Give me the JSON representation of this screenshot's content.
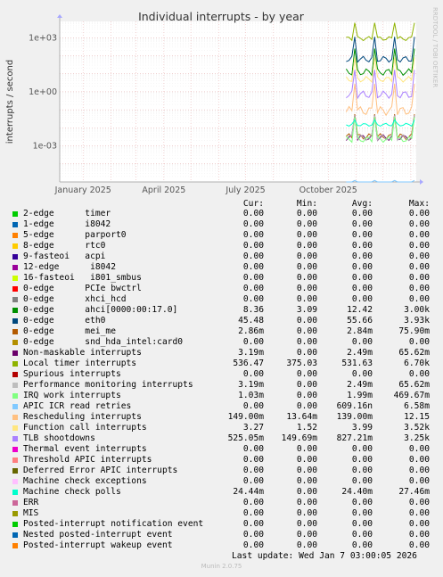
{
  "side_label": "RRDTOOL / TOBI OETIKER",
  "headers": {
    "cur": "Cur:",
    "min": "Min:",
    "avg": "Avg:",
    "max": "Max:"
  },
  "chart_data": {
    "type": "line",
    "title": "Individual interrupts - by year",
    "ylabel": "interrupts / second",
    "y_scale": "log",
    "ylim": [
      1e-05,
      8000
    ],
    "yticks": [
      {
        "v": 0.001,
        "label": "1e-03"
      },
      {
        "v": 1,
        "label": "1e+00"
      },
      {
        "v": 1000,
        "label": "1e+03"
      }
    ],
    "x_domain": [
      "2024-12-06",
      "2026-01-07"
    ],
    "xticks": [
      {
        "d": "2025-01-01",
        "label": "January 2025"
      },
      {
        "d": "2025-04-01",
        "label": "April 2025"
      },
      {
        "d": "2025-07-01",
        "label": "July 2025"
      },
      {
        "d": "2025-10-01",
        "label": "October 2025"
      }
    ],
    "data_start": "2025-10-21",
    "grid": true,
    "series": [
      {
        "name": "2-edge      timer",
        "color": "#00cc00",
        "cur": "0.00",
        "min": "0.00",
        "avg": "0.00",
        "max": "0.00"
      },
      {
        "name": "1-edge      i8042",
        "color": "#0066b3",
        "cur": "0.00",
        "min": "0.00",
        "avg": "0.00",
        "max": "0.00"
      },
      {
        "name": "5-edge      parport0",
        "color": "#ff8000",
        "cur": "0.00",
        "min": "0.00",
        "avg": "0.00",
        "max": "0.00"
      },
      {
        "name": "8-edge      rtc0",
        "color": "#ffcc00",
        "cur": "0.00",
        "min": "0.00",
        "avg": "0.00",
        "max": "0.00"
      },
      {
        "name": "9-fasteoi   acpi",
        "color": "#330099",
        "cur": "0.00",
        "min": "0.00",
        "avg": "0.00",
        "max": "0.00"
      },
      {
        "name": "12-edge      i8042",
        "color": "#990099",
        "cur": "0.00",
        "min": "0.00",
        "avg": "0.00",
        "max": "0.00"
      },
      {
        "name": "16-fasteoi   i801_smbus",
        "color": "#ccff00",
        "cur": "0.00",
        "min": "0.00",
        "avg": "0.00",
        "max": "0.00"
      },
      {
        "name": "0-edge      PCIe bwctrl",
        "color": "#ff0000",
        "cur": "0.00",
        "min": "0.00",
        "avg": "0.00",
        "max": "0.00"
      },
      {
        "name": "0-edge      xhci_hcd",
        "color": "#808080",
        "cur": "0.00",
        "min": "0.00",
        "avg": "0.00",
        "max": "0.00"
      },
      {
        "name": "0-edge      ahci[0000:00:17.0]",
        "color": "#008f00",
        "cur": "8.36",
        "min": "3.09",
        "avg": "12.42",
        "max": "3.00k"
      },
      {
        "name": "0-edge      eth0",
        "color": "#00487d",
        "cur": "45.48",
        "min": "0.00",
        "avg": "55.66",
        "max": "3.93k"
      },
      {
        "name": "0-edge      mei_me",
        "color": "#b35a00",
        "cur": "2.86m",
        "min": "0.00",
        "avg": "2.84m",
        "max": "75.90m"
      },
      {
        "name": "0-edge      snd_hda_intel:card0",
        "color": "#b38f00",
        "cur": "0.00",
        "min": "0.00",
        "avg": "0.00",
        "max": "0.00"
      },
      {
        "name": "Non-maskable interrupts",
        "color": "#6b006b",
        "cur": "3.19m",
        "min": "0.00",
        "avg": "2.49m",
        "max": "65.62m"
      },
      {
        "name": "Local timer interrupts",
        "color": "#8fb300",
        "cur": "536.47",
        "min": "375.03",
        "avg": "531.63",
        "max": "6.70k"
      },
      {
        "name": "Spurious interrupts",
        "color": "#b30000",
        "cur": "0.00",
        "min": "0.00",
        "avg": "0.00",
        "max": "0.00"
      },
      {
        "name": "Performance monitoring interrupts",
        "color": "#bebebe",
        "cur": "3.19m",
        "min": "0.00",
        "avg": "2.49m",
        "max": "65.62m"
      },
      {
        "name": "IRQ work interrupts",
        "color": "#80ff80",
        "cur": "1.03m",
        "min": "0.00",
        "avg": "1.99m",
        "max": "469.67m"
      },
      {
        "name": "APIC ICR read retries",
        "color": "#80c9ff",
        "cur": "0.00",
        "min": "0.00",
        "avg": "609.16n",
        "max": "6.58m"
      },
      {
        "name": "Rescheduling interrupts",
        "color": "#ffc080",
        "cur": "149.00m",
        "min": "13.64m",
        "avg": "139.00m",
        "max": "12.15"
      },
      {
        "name": "Function call interrupts",
        "color": "#ffe680",
        "cur": "3.27",
        "min": "1.52",
        "avg": "3.99",
        "max": "3.52k"
      },
      {
        "name": "TLB shootdowns",
        "color": "#aa80ff",
        "cur": "525.05m",
        "min": "149.69m",
        "avg": "827.21m",
        "max": "3.25k"
      },
      {
        "name": "Thermal event interrupts",
        "color": "#ee00cc",
        "cur": "0.00",
        "min": "0.00",
        "avg": "0.00",
        "max": "0.00"
      },
      {
        "name": "Threshold APIC interrupts",
        "color": "#ff8080",
        "cur": "0.00",
        "min": "0.00",
        "avg": "0.00",
        "max": "0.00"
      },
      {
        "name": "Deferred Error APIC interrupts",
        "color": "#666600",
        "cur": "0.00",
        "min": "0.00",
        "avg": "0.00",
        "max": "0.00"
      },
      {
        "name": "Machine check exceptions",
        "color": "#ffbfff",
        "cur": "0.00",
        "min": "0.00",
        "avg": "0.00",
        "max": "0.00"
      },
      {
        "name": "Machine check polls",
        "color": "#00ffcc",
        "cur": "24.44m",
        "min": "0.00",
        "avg": "24.40m",
        "max": "27.46m"
      },
      {
        "name": "ERR",
        "color": "#cc6699",
        "cur": "0.00",
        "min": "0.00",
        "avg": "0.00",
        "max": "0.00"
      },
      {
        "name": "MIS",
        "color": "#999900",
        "cur": "0.00",
        "min": "0.00",
        "avg": "0.00",
        "max": "0.00"
      },
      {
        "name": "Posted-interrupt notification event",
        "color": "#00cc00",
        "cur": "0.00",
        "min": "0.00",
        "avg": "0.00",
        "max": "0.00"
      },
      {
        "name": "Nested posted-interrupt event",
        "color": "#0066b3",
        "cur": "0.00",
        "min": "0.00",
        "avg": "0.00",
        "max": "0.00"
      },
      {
        "name": "Posted-interrupt wakeup event",
        "color": "#ff8000",
        "cur": "0.00",
        "min": "0.00",
        "avg": "0.00",
        "max": "0.00"
      }
    ]
  },
  "footer": {
    "last_update": "Last update: Wed Jan  7 03:00:05 2026",
    "version": "Munin 2.0.75"
  }
}
